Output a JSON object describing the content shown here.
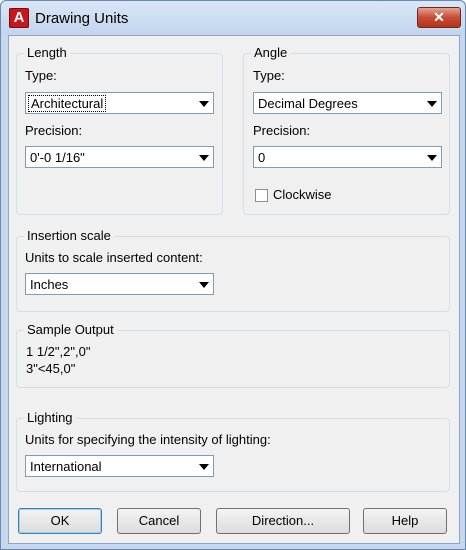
{
  "window": {
    "title": "Drawing Units",
    "app_icon_glyph": "A",
    "close_glyph": "✕"
  },
  "length": {
    "legend": "Length",
    "type_label": "Type:",
    "type_value": "Architectural",
    "precision_label": "Precision:",
    "precision_value": "0'-0 1/16\""
  },
  "angle": {
    "legend": "Angle",
    "type_label": "Type:",
    "type_value": "Decimal Degrees",
    "precision_label": "Precision:",
    "precision_value": "0",
    "clockwise_label": "Clockwise",
    "clockwise_checked": false
  },
  "insertion": {
    "legend": "Insertion scale",
    "units_label": "Units to scale inserted content:",
    "units_value": "Inches"
  },
  "sample": {
    "legend": "Sample Output",
    "line1": "1 1/2\",2\",0\"",
    "line2": "3\"<45,0\""
  },
  "lighting": {
    "legend": "Lighting",
    "units_label": "Units for specifying the intensity of lighting:",
    "units_value": "International"
  },
  "buttons": {
    "ok": "OK",
    "cancel": "Cancel",
    "direction": "Direction...",
    "help": "Help"
  },
  "colors": {
    "title_bar": "#c7d8ee",
    "close_button": "#c54c35",
    "app_icon": "#c8161d",
    "dialog_bg": "#f0f0f0"
  }
}
